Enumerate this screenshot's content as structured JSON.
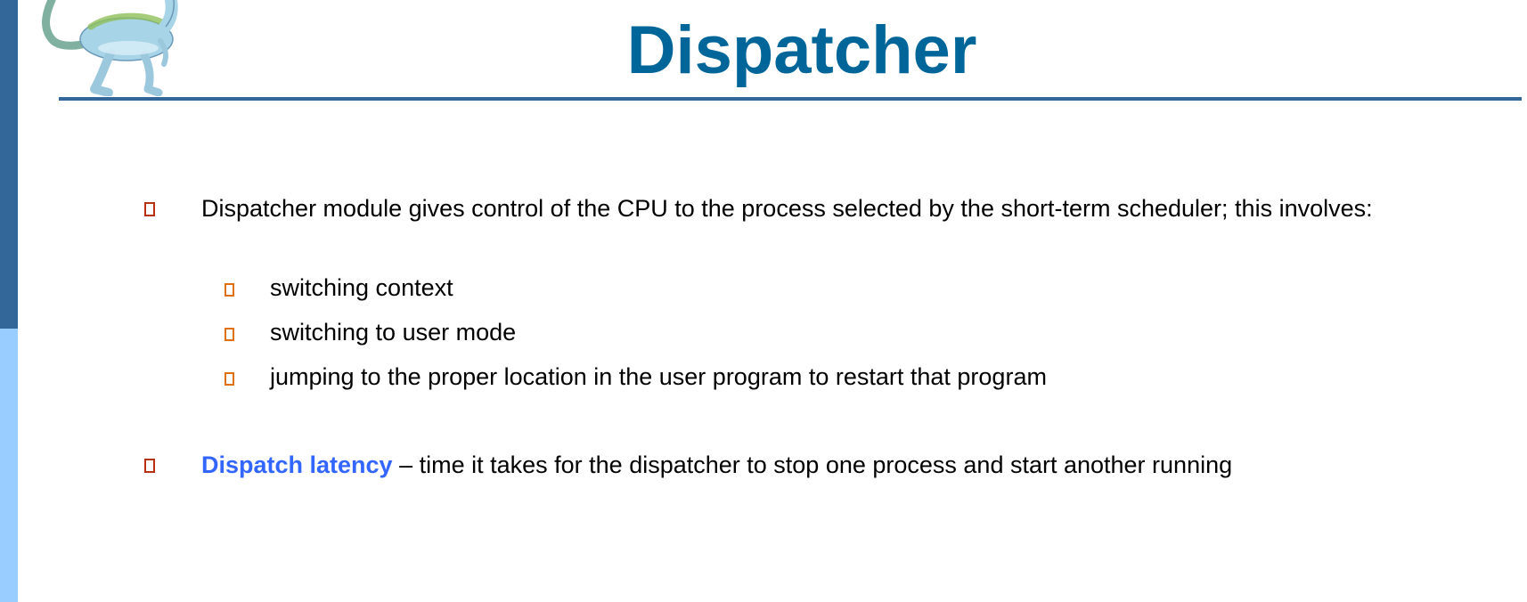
{
  "slide": {
    "title": "Dispatcher",
    "logo_icon": "dinosaur-logo-icon",
    "colors": {
      "title": "#006699",
      "rule": "#336699",
      "left_bar_dark": "#336699",
      "left_bar_light": "#99ccff",
      "bullet_level1": "#b83010",
      "bullet_level2": "#e07010",
      "term_highlight": "#3366ff"
    },
    "bullets": [
      {
        "text": "Dispatcher module gives control of the CPU to the process selected by the short-term scheduler; this involves:",
        "sub_items": [
          "switching context",
          "switching to user mode",
          "jumping to the proper location in the user program to restart that program"
        ]
      },
      {
        "term": "Dispatch latency",
        "text": " – time it takes for the dispatcher to stop one process and start another running"
      }
    ]
  }
}
